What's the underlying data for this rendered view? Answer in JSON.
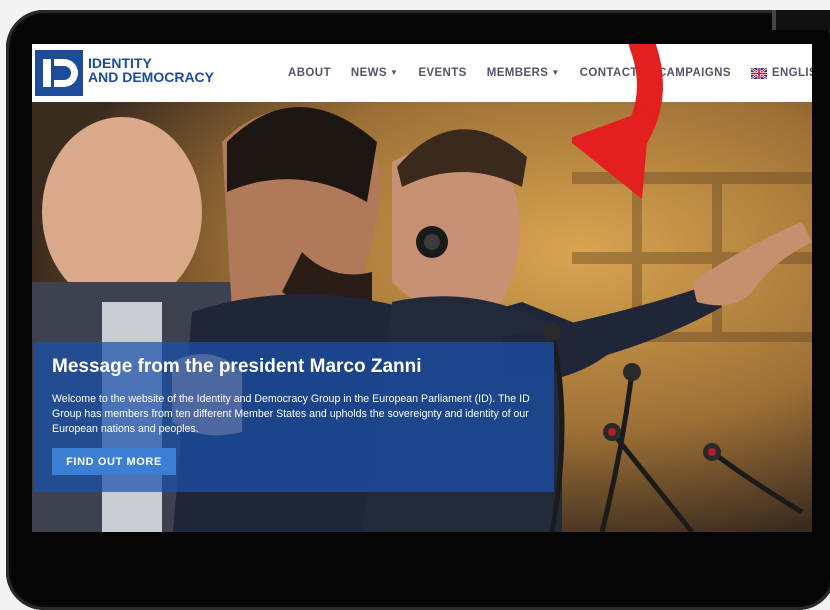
{
  "brand": {
    "line1": "IDENTITY",
    "line2": "AND DEMOCRACY",
    "logo_letters": "ID",
    "color": "#1d4b9b"
  },
  "nav": {
    "items": [
      {
        "label": "ABOUT",
        "dropdown": false
      },
      {
        "label": "NEWS",
        "dropdown": true
      },
      {
        "label": "EVENTS",
        "dropdown": false
      },
      {
        "label": "MEMBERS",
        "dropdown": true
      },
      {
        "label": "CONTACT",
        "dropdown": false
      },
      {
        "label": "CAMPAIGNS",
        "dropdown": false
      }
    ],
    "language": "ENGLISH",
    "flag_icon": "uk-flag-icon"
  },
  "hero": {
    "title": "Message from the president Marco Zanni",
    "text": "Welcome to the website of the Identity and Democracy Group in the European Parliament (ID). The ID Group has members from ten different Member States and upholds the sovereignty and identity of our European nations and peoples.",
    "cta": "FIND OUT MORE",
    "box_color": "#1b50aa"
  },
  "overlay": {
    "arrow_icon": "red-curved-arrow-icon",
    "arrow_color": "#e41f1f"
  }
}
